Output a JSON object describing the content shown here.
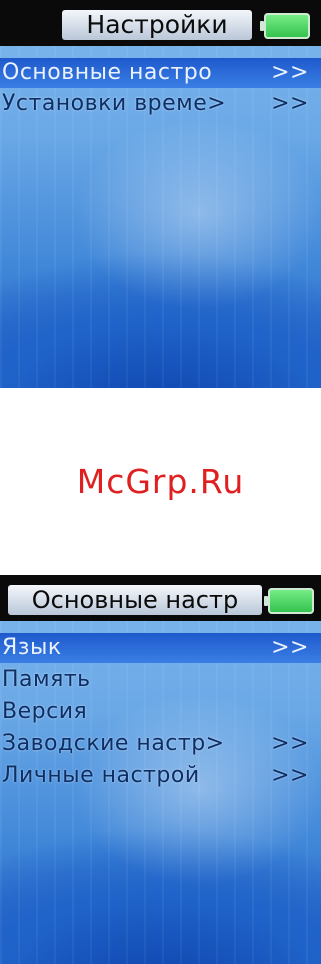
{
  "screen1": {
    "title": "Настройки",
    "items": [
      {
        "label": "Основные настро",
        "arrow": ">>"
      },
      {
        "label": "Установки време>",
        "arrow": ">>"
      }
    ]
  },
  "watermark": "McGrp.Ru",
  "screen2": {
    "title": "Основные настр",
    "items": [
      {
        "label": "Язык",
        "arrow": ">>"
      },
      {
        "label": "Память",
        "arrow": ""
      },
      {
        "label": "Версия",
        "arrow": ""
      },
      {
        "label": "Заводские настр>",
        "arrow": ">>"
      },
      {
        "label": "Личные настрой",
        "arrow": ">>"
      }
    ]
  }
}
